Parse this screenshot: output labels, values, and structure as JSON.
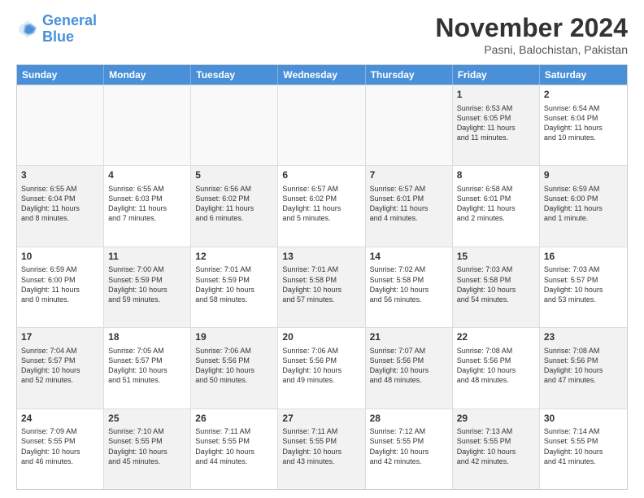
{
  "header": {
    "logo_line1": "General",
    "logo_line2": "Blue",
    "title": "November 2024",
    "location": "Pasni, Balochistan, Pakistan"
  },
  "weekdays": [
    "Sunday",
    "Monday",
    "Tuesday",
    "Wednesday",
    "Thursday",
    "Friday",
    "Saturday"
  ],
  "rows": [
    {
      "cells": [
        {
          "day": "",
          "text": "",
          "empty": true
        },
        {
          "day": "",
          "text": "",
          "empty": true
        },
        {
          "day": "",
          "text": "",
          "empty": true
        },
        {
          "day": "",
          "text": "",
          "empty": true
        },
        {
          "day": "",
          "text": "",
          "empty": true
        },
        {
          "day": "1",
          "text": "Sunrise: 6:53 AM\nSunset: 6:05 PM\nDaylight: 11 hours\nand 11 minutes.",
          "shaded": true
        },
        {
          "day": "2",
          "text": "Sunrise: 6:54 AM\nSunset: 6:04 PM\nDaylight: 11 hours\nand 10 minutes.",
          "shaded": false
        }
      ]
    },
    {
      "cells": [
        {
          "day": "3",
          "text": "Sunrise: 6:55 AM\nSunset: 6:04 PM\nDaylight: 11 hours\nand 8 minutes.",
          "shaded": true
        },
        {
          "day": "4",
          "text": "Sunrise: 6:55 AM\nSunset: 6:03 PM\nDaylight: 11 hours\nand 7 minutes.",
          "shaded": false
        },
        {
          "day": "5",
          "text": "Sunrise: 6:56 AM\nSunset: 6:02 PM\nDaylight: 11 hours\nand 6 minutes.",
          "shaded": true
        },
        {
          "day": "6",
          "text": "Sunrise: 6:57 AM\nSunset: 6:02 PM\nDaylight: 11 hours\nand 5 minutes.",
          "shaded": false
        },
        {
          "day": "7",
          "text": "Sunrise: 6:57 AM\nSunset: 6:01 PM\nDaylight: 11 hours\nand 4 minutes.",
          "shaded": true
        },
        {
          "day": "8",
          "text": "Sunrise: 6:58 AM\nSunset: 6:01 PM\nDaylight: 11 hours\nand 2 minutes.",
          "shaded": false
        },
        {
          "day": "9",
          "text": "Sunrise: 6:59 AM\nSunset: 6:00 PM\nDaylight: 11 hours\nand 1 minute.",
          "shaded": true
        }
      ]
    },
    {
      "cells": [
        {
          "day": "10",
          "text": "Sunrise: 6:59 AM\nSunset: 6:00 PM\nDaylight: 11 hours\nand 0 minutes.",
          "shaded": false
        },
        {
          "day": "11",
          "text": "Sunrise: 7:00 AM\nSunset: 5:59 PM\nDaylight: 10 hours\nand 59 minutes.",
          "shaded": true
        },
        {
          "day": "12",
          "text": "Sunrise: 7:01 AM\nSunset: 5:59 PM\nDaylight: 10 hours\nand 58 minutes.",
          "shaded": false
        },
        {
          "day": "13",
          "text": "Sunrise: 7:01 AM\nSunset: 5:58 PM\nDaylight: 10 hours\nand 57 minutes.",
          "shaded": true
        },
        {
          "day": "14",
          "text": "Sunrise: 7:02 AM\nSunset: 5:58 PM\nDaylight: 10 hours\nand 56 minutes.",
          "shaded": false
        },
        {
          "day": "15",
          "text": "Sunrise: 7:03 AM\nSunset: 5:58 PM\nDaylight: 10 hours\nand 54 minutes.",
          "shaded": true
        },
        {
          "day": "16",
          "text": "Sunrise: 7:03 AM\nSunset: 5:57 PM\nDaylight: 10 hours\nand 53 minutes.",
          "shaded": false
        }
      ]
    },
    {
      "cells": [
        {
          "day": "17",
          "text": "Sunrise: 7:04 AM\nSunset: 5:57 PM\nDaylight: 10 hours\nand 52 minutes.",
          "shaded": true
        },
        {
          "day": "18",
          "text": "Sunrise: 7:05 AM\nSunset: 5:57 PM\nDaylight: 10 hours\nand 51 minutes.",
          "shaded": false
        },
        {
          "day": "19",
          "text": "Sunrise: 7:06 AM\nSunset: 5:56 PM\nDaylight: 10 hours\nand 50 minutes.",
          "shaded": true
        },
        {
          "day": "20",
          "text": "Sunrise: 7:06 AM\nSunset: 5:56 PM\nDaylight: 10 hours\nand 49 minutes.",
          "shaded": false
        },
        {
          "day": "21",
          "text": "Sunrise: 7:07 AM\nSunset: 5:56 PM\nDaylight: 10 hours\nand 48 minutes.",
          "shaded": true
        },
        {
          "day": "22",
          "text": "Sunrise: 7:08 AM\nSunset: 5:56 PM\nDaylight: 10 hours\nand 48 minutes.",
          "shaded": false
        },
        {
          "day": "23",
          "text": "Sunrise: 7:08 AM\nSunset: 5:56 PM\nDaylight: 10 hours\nand 47 minutes.",
          "shaded": true
        }
      ]
    },
    {
      "cells": [
        {
          "day": "24",
          "text": "Sunrise: 7:09 AM\nSunset: 5:55 PM\nDaylight: 10 hours\nand 46 minutes.",
          "shaded": false
        },
        {
          "day": "25",
          "text": "Sunrise: 7:10 AM\nSunset: 5:55 PM\nDaylight: 10 hours\nand 45 minutes.",
          "shaded": true
        },
        {
          "day": "26",
          "text": "Sunrise: 7:11 AM\nSunset: 5:55 PM\nDaylight: 10 hours\nand 44 minutes.",
          "shaded": false
        },
        {
          "day": "27",
          "text": "Sunrise: 7:11 AM\nSunset: 5:55 PM\nDaylight: 10 hours\nand 43 minutes.",
          "shaded": true
        },
        {
          "day": "28",
          "text": "Sunrise: 7:12 AM\nSunset: 5:55 PM\nDaylight: 10 hours\nand 42 minutes.",
          "shaded": false
        },
        {
          "day": "29",
          "text": "Sunrise: 7:13 AM\nSunset: 5:55 PM\nDaylight: 10 hours\nand 42 minutes.",
          "shaded": true
        },
        {
          "day": "30",
          "text": "Sunrise: 7:14 AM\nSunset: 5:55 PM\nDaylight: 10 hours\nand 41 minutes.",
          "shaded": false
        }
      ]
    }
  ]
}
